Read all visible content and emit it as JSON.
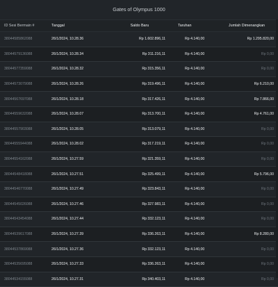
{
  "title": "Gates of Olympus 1000",
  "columns": {
    "game_id": "ID Sesi Bermain #",
    "date": "Tanggal",
    "balance": "Saldo Baru",
    "bet": "Taruhan",
    "win": "Jumlah Dimenangkan"
  },
  "rows": [
    {
      "id": "38044585862088",
      "date": "26/1/2024, 10.28.36",
      "balance": "Rp 1.602.896,11",
      "bet": "Rp 4.140,00",
      "win": "Rp 1.295.820,00"
    },
    {
      "id": "38044579136088",
      "date": "26/1/2024, 10.28.34",
      "balance": "Rp 311.216,11",
      "bet": "Rp 4.140,00",
      "win": "Rp 0,00"
    },
    {
      "id": "38044577359088",
      "date": "26/1/2024, 10.28.32",
      "balance": "Rp 315.356,11",
      "bet": "Rp 4.140,00",
      "win": "Rp 0,00"
    },
    {
      "id": "38044573079088",
      "date": "26/1/2024, 10.28.26",
      "balance": "Rp 319.496,11",
      "bet": "Rp 4.140,00",
      "win": "Rp 6.210,00"
    },
    {
      "id": "38044567697088",
      "date": "26/1/2024, 10.28.18",
      "balance": "Rp 317.426,11",
      "bet": "Rp 4.140,00",
      "win": "Rp 7.866,00"
    },
    {
      "id": "38044559632088",
      "date": "26/1/2024, 10.28.07",
      "balance": "Rp 313.700,11",
      "bet": "Rp 4.140,00",
      "win": "Rp 4.761,00"
    },
    {
      "id": "38044557903088",
      "date": "26/1/2024, 10.28.05",
      "balance": "Rp 313.079,11",
      "bet": "Rp 4.140,00",
      "win": "Rp 0,00"
    },
    {
      "id": "38044555944088",
      "date": "26/1/2024, 10.28.02",
      "balance": "Rp 317.219,11",
      "bet": "Rp 4.140,00",
      "win": "Rp 0,00"
    },
    {
      "id": "38044554162088",
      "date": "26/1/2024, 10.27.59",
      "balance": "Rp 321.359,11",
      "bet": "Rp 4.140,00",
      "win": "Rp 0,00"
    },
    {
      "id": "38044548418088",
      "date": "26/1/2024, 10.27.51",
      "balance": "Rp 325.499,11",
      "bet": "Rp 4.140,00",
      "win": "Rp 5.796,00"
    },
    {
      "id": "38044546770088",
      "date": "26/1/2024, 10.27.49",
      "balance": "Rp 323.843,11",
      "bet": "Rp 4.140,00",
      "win": "Rp 0,00"
    },
    {
      "id": "38044545026088",
      "date": "26/1/2024, 10.27.46",
      "balance": "Rp 327.983,11",
      "bet": "Rp 4.140,00",
      "win": "Rp 0,00"
    },
    {
      "id": "38044543454088",
      "date": "26/1/2024, 10.27.44",
      "balance": "Rp 332.123,11",
      "bet": "Rp 4.140,00",
      "win": "Rp 0,00"
    },
    {
      "id": "38044539617088",
      "date": "26/1/2024, 10.27.39",
      "balance": "Rp 336.263,11",
      "bet": "Rp 4.140,00",
      "win": "Rp 8.280,00"
    },
    {
      "id": "38044537869088",
      "date": "26/1/2024, 10.27.36",
      "balance": "Rp 332.123,11",
      "bet": "Rp 4.140,00",
      "win": "Rp 0,00"
    },
    {
      "id": "38044535695088",
      "date": "26/1/2024, 10.27.33",
      "balance": "Rp 336.263,11",
      "bet": "Rp 4.140,00",
      "win": "Rp 0,00"
    },
    {
      "id": "38044534155088",
      "date": "26/1/2024, 10.27.31",
      "balance": "Rp 340.403,11",
      "bet": "Rp 4.140,00",
      "win": "Rp 0,00"
    }
  ]
}
